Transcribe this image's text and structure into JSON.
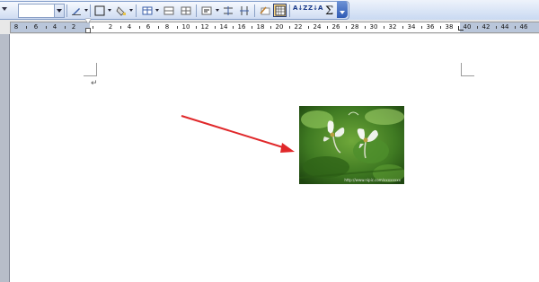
{
  "toolbar": {
    "font_size_value": "",
    "buttons": [
      "pen-icon",
      "borders-icon",
      "shading-icon",
      "insert-table-icon",
      "merge-cells-icon",
      "split-cells-icon",
      "align-icon",
      "distribute-rows-icon",
      "distribute-columns-icon",
      "table-autoformat-icon",
      "show-gridlines-icon",
      "sort-ascending-icon",
      "sort-descending-icon",
      "autosum-icon"
    ],
    "sort_ascending_label": "A↓Z",
    "sort_descending_label": "Z↓A",
    "autosum_label": "Σ"
  },
  "ruler": {
    "labels": [
      "8",
      "6",
      "4",
      "2",
      "2",
      "4",
      "6",
      "8",
      "10",
      "12",
      "14",
      "16",
      "18",
      "20",
      "22",
      "24",
      "26",
      "28",
      "30",
      "32",
      "34",
      "36",
      "38",
      "40",
      "42",
      "44",
      "46"
    ]
  },
  "document": {
    "paragraph_mark": "↵",
    "image": {
      "description_icon": "flower-photo",
      "watermark": "http://www.nipic.com/xxxxxxxx"
    },
    "annotation_color": "#e0282a"
  },
  "colors": {
    "toolbar_bg": "#c9d9f2",
    "accent": "#2f5bb5",
    "arrow": "#e0282a"
  }
}
